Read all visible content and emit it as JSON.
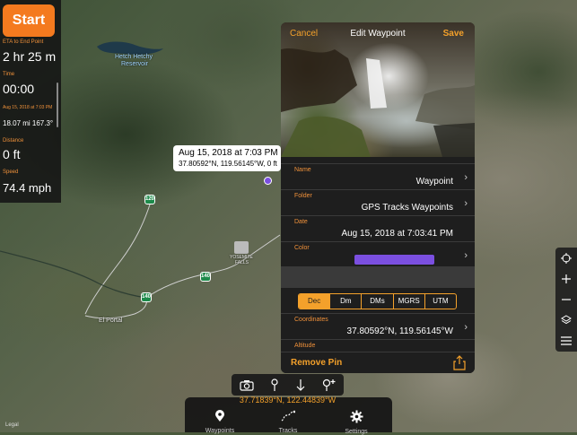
{
  "map": {
    "lake_label_line1": "Hetch Hetchy",
    "lake_label_line2": "Reservoir",
    "poi_label_line1": "YOSEMITE",
    "poi_label_line2": "FALLS",
    "town_label": "El Portal",
    "routes": [
      "120",
      "140",
      "140"
    ],
    "legal": "Legal"
  },
  "stats": {
    "start_label": "Start",
    "eta_label": "ETA to End Point",
    "eta_value": "2 hr 25 m",
    "time_label": "Time",
    "time_value": "00:00",
    "date_value": "Aug 15, 2018 at 7:03 PM",
    "distance_bearing": "18.07 mi 167.3°",
    "distance_label": "Distance",
    "distance_value": "0 ft",
    "speed_label": "Speed",
    "speed_value": "74.4 mph"
  },
  "callout": {
    "title": "Aug 15, 2018 at 7:03 PM 1",
    "subtitle": "37.80592°N, 119.56145°W, 0 ft"
  },
  "edit_panel": {
    "cancel_label": "Cancel",
    "title": "Edit Waypoint",
    "save_label": "Save",
    "name_label": "Name",
    "name_value": "Waypoint",
    "folder_label": "Folder",
    "folder_value": "GPS Tracks Waypoints",
    "date_label": "Date",
    "date_value": "Aug 15, 2018 at 7:03:41 PM",
    "color_label": "Color",
    "color_value": "#7b4fe0",
    "formats": [
      "Dec",
      "Dm",
      "DMs",
      "MGRS",
      "UTM"
    ],
    "active_format": "Dec",
    "coordinates_label": "Coordinates",
    "coordinates_value": "37.80592°N, 119.56145°W",
    "altitude_label": "Altitude",
    "remove_label": "Remove Pin"
  },
  "toolbar": {
    "icons": [
      "camera-icon",
      "pin-icon",
      "arrow-down-icon",
      "add-pin-icon"
    ],
    "coordinates": "37.71839°N, 122.44839°W"
  },
  "tabs": [
    {
      "label": "Waypoints",
      "icon": "waypoint-icon"
    },
    {
      "label": "Tracks",
      "icon": "tracks-icon"
    },
    {
      "label": "Settings",
      "icon": "gear-icon"
    }
  ],
  "colors": {
    "accent": "#f4a12b",
    "start": "#f47a1f",
    "waypoint": "#7b4fe0"
  }
}
